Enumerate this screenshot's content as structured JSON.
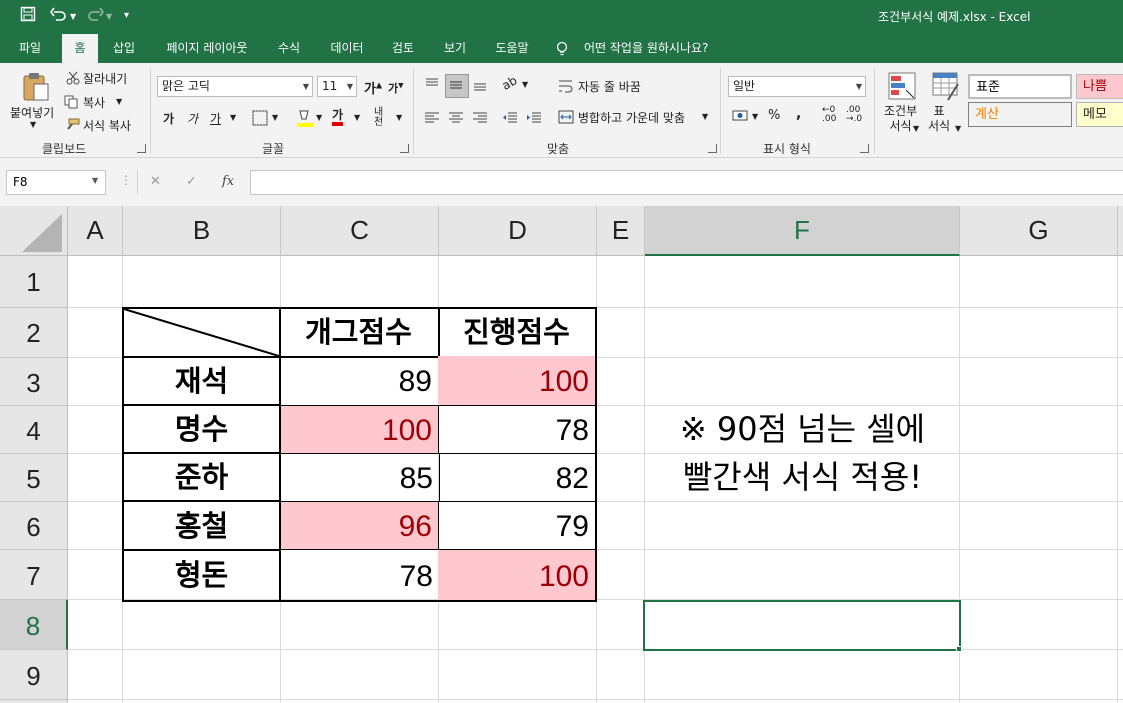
{
  "titlebar": {
    "title": "조건부서식 예제.xlsx  -  Excel",
    "bg_color": "#217346"
  },
  "ribbon_tabs": [
    "파일",
    "홈",
    "삽입",
    "페이지 레이아웃",
    "수식",
    "데이터",
    "검토",
    "보기",
    "도움말"
  ],
  "tell_me": "어떤 작업을 원하시나요?",
  "clipboard": {
    "paste": "붙여넣기",
    "cut": "잘라내기",
    "copy": "복사",
    "format_painter": "서식 복사",
    "group": "클립보드"
  },
  "font": {
    "name": "맑은 고딕",
    "size": "11",
    "group": "글꼴"
  },
  "alignment": {
    "wrap": "자동 줄 바꿈",
    "merge": "병합하고 가운데 맞춤",
    "group": "맞춤"
  },
  "number": {
    "format": "일반",
    "group": "표시 형식"
  },
  "styles": {
    "conditional": "조건부\n서식",
    "table": "표\n서식",
    "normal": "표준",
    "bad": "나쁨",
    "calc": "계산",
    "memo": "메모"
  },
  "name_box": "F8",
  "formula_value": "",
  "columns": [
    "A",
    "B",
    "C",
    "D",
    "E",
    "F",
    "G"
  ],
  "rows": [
    "1",
    "2",
    "3",
    "4",
    "5",
    "6",
    "7",
    "8",
    "9"
  ],
  "table": {
    "headers": [
      "개그점수",
      "진행점수"
    ],
    "rows": [
      {
        "name": "재석",
        "c": "89",
        "d": "100"
      },
      {
        "name": "명수",
        "c": "100",
        "d": "78"
      },
      {
        "name": "준하",
        "c": "85",
        "d": "82"
      },
      {
        "name": "홍철",
        "c": "96",
        "d": "79"
      },
      {
        "name": "형돈",
        "c": "78",
        "d": "100"
      }
    ]
  },
  "note": {
    "line1": "※ 90점 넘는 셀에",
    "line2": "빨간색 서식 적용!"
  },
  "colors": {
    "highlight_fill": "#ffc7ce",
    "highlight_text": "#9c0006",
    "excel_green": "#217346"
  }
}
